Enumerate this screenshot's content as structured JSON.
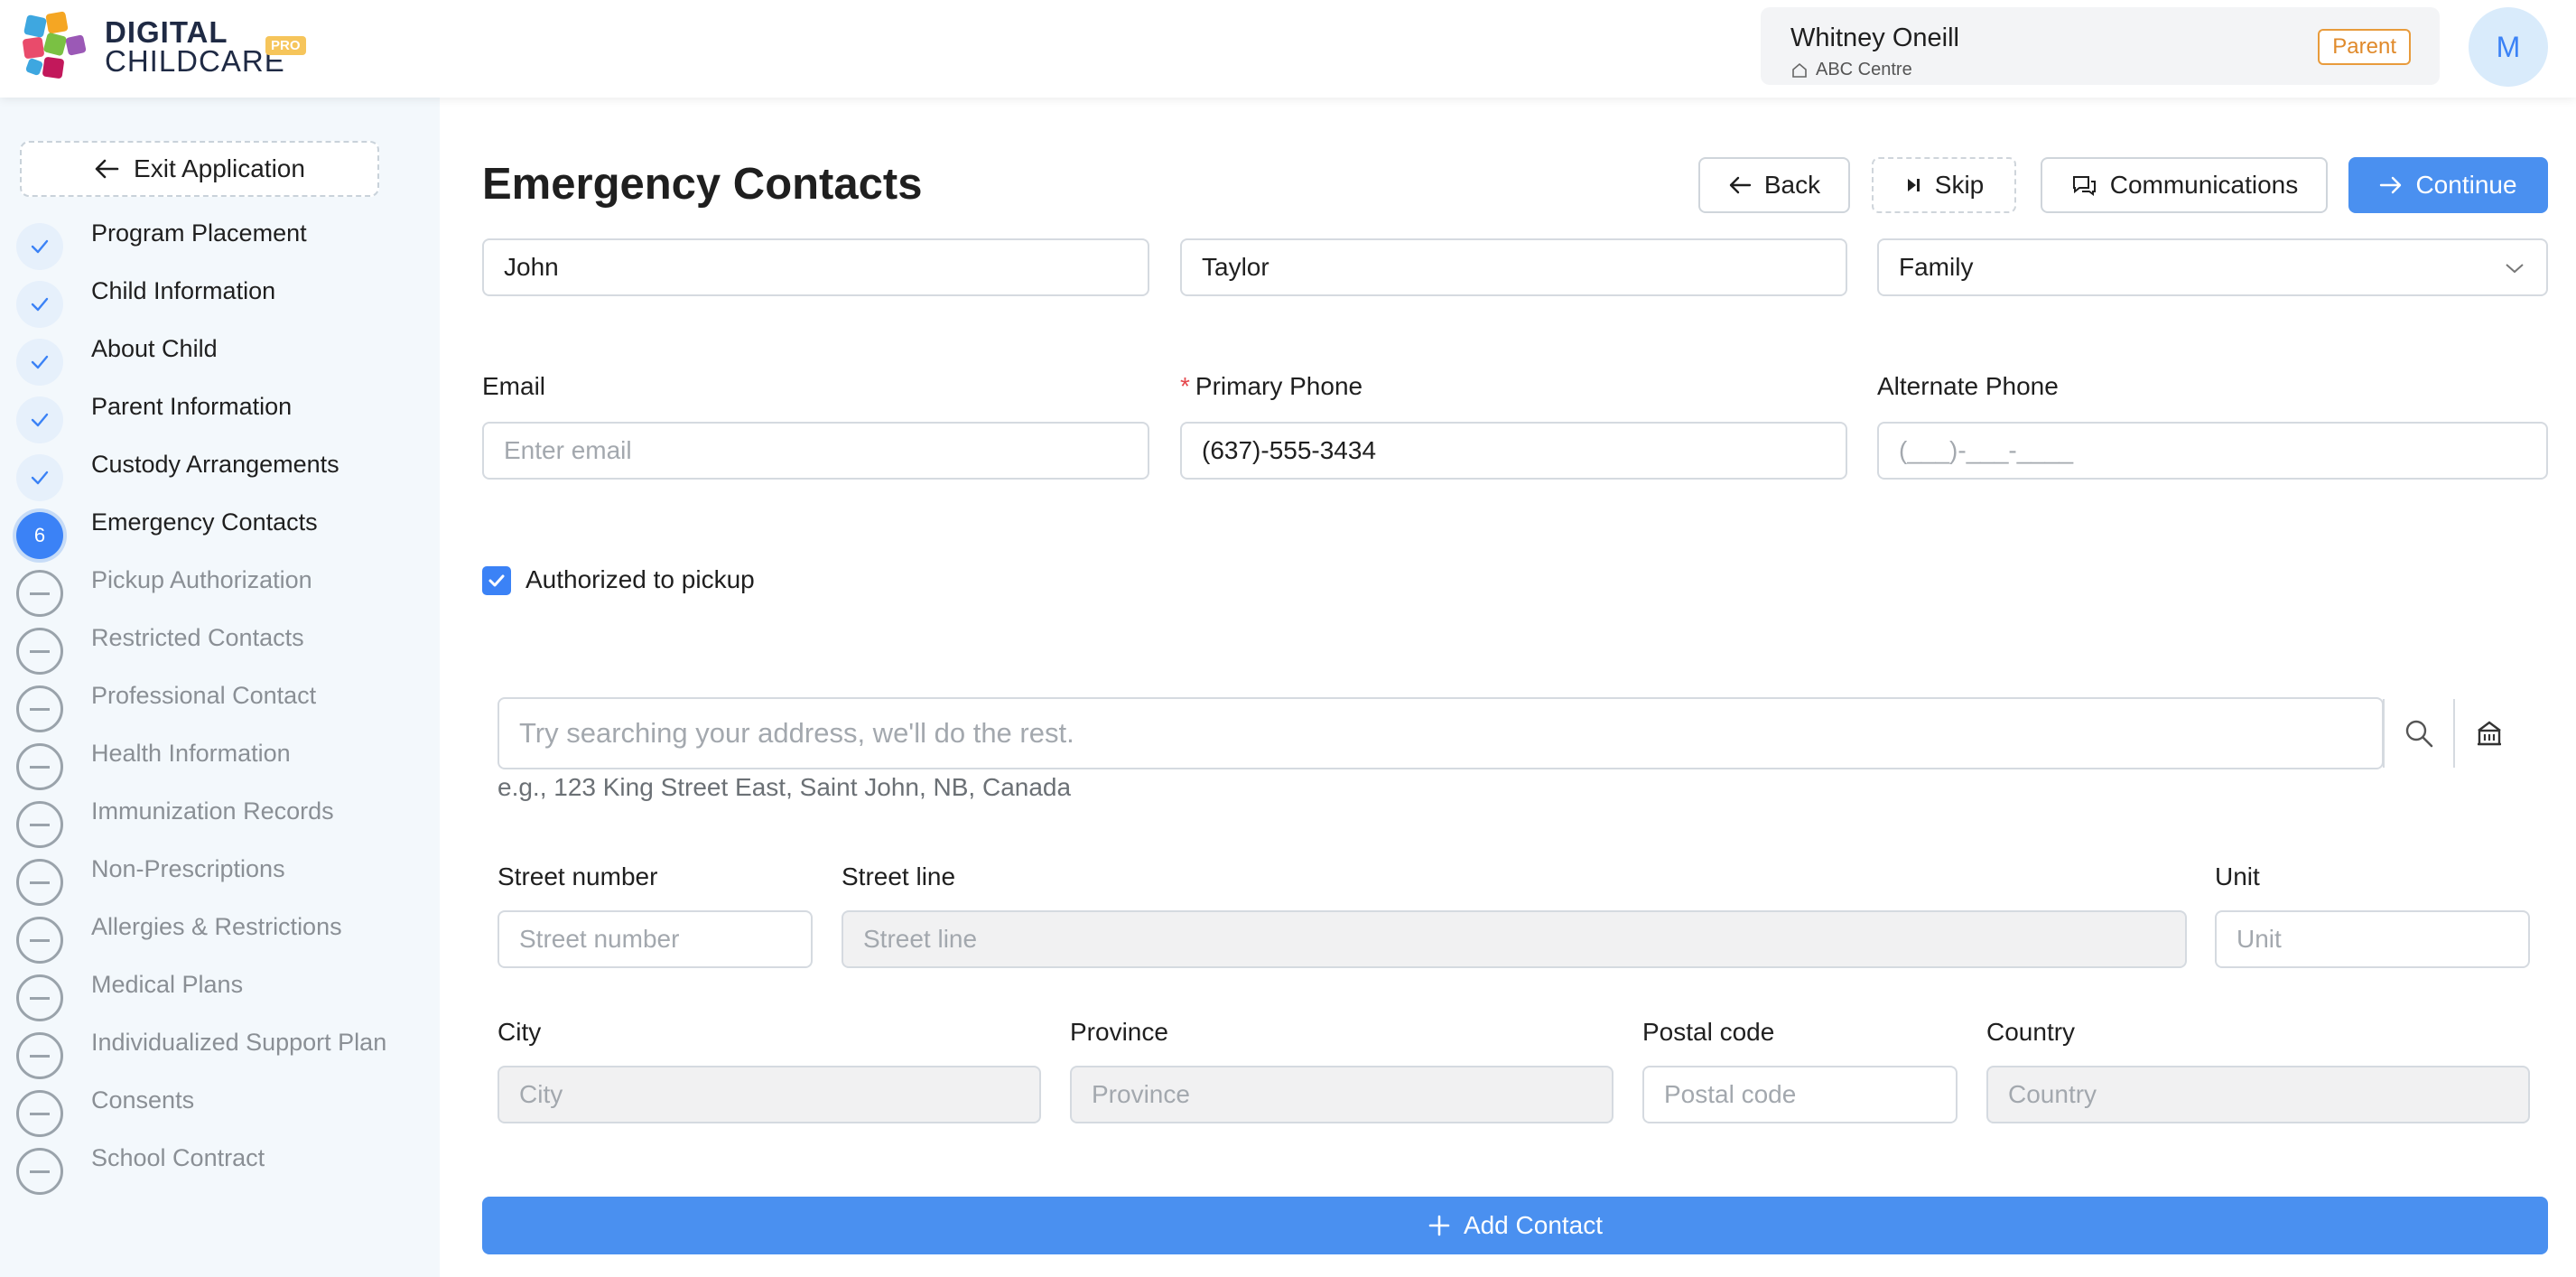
{
  "brand": {
    "line1": "DIGITAL",
    "line2": "CHILDCARE",
    "badge": "PRO"
  },
  "user": {
    "name": "Whitney Oneill",
    "centre": "ABC Centre",
    "role": "Parent",
    "avatar_initial": "M"
  },
  "sidebar": {
    "exit_label": "Exit Application",
    "steps": [
      {
        "label": "Program Placement",
        "status": "done"
      },
      {
        "label": "Child Information",
        "status": "done"
      },
      {
        "label": "About Child",
        "status": "done"
      },
      {
        "label": "Parent Information",
        "status": "done"
      },
      {
        "label": "Custody Arrangements",
        "status": "done"
      },
      {
        "label": "Emergency Contacts",
        "status": "current",
        "number": "6"
      },
      {
        "label": "Pickup Authorization",
        "status": "todo"
      },
      {
        "label": "Restricted Contacts",
        "status": "todo"
      },
      {
        "label": "Professional Contact",
        "status": "todo"
      },
      {
        "label": "Health Information",
        "status": "todo"
      },
      {
        "label": "Immunization Records",
        "status": "todo"
      },
      {
        "label": "Non-Prescriptions",
        "status": "todo"
      },
      {
        "label": "Allergies & Restrictions",
        "status": "todo"
      },
      {
        "label": "Medical Plans",
        "status": "todo"
      },
      {
        "label": "Individualized Support Plan",
        "status": "todo"
      },
      {
        "label": "Consents",
        "status": "todo"
      },
      {
        "label": "School Contract",
        "status": "todo"
      }
    ]
  },
  "page": {
    "title": "Emergency Contacts",
    "back_label": "Back",
    "skip_label": "Skip",
    "communications_label": "Communications",
    "continue_label": "Continue"
  },
  "contact": {
    "first_name": "John",
    "last_name": "Taylor",
    "relationship": "Family",
    "email_label": "Email",
    "email_placeholder": "Enter email",
    "primary_phone_label": "Primary Phone",
    "primary_phone_required": "*",
    "primary_phone": "(637)-555-3434",
    "alternate_phone_label": "Alternate Phone",
    "alternate_phone_placeholder": "(___)-___-____",
    "authorized_label": "Authorized to pickup",
    "authorized": true
  },
  "address": {
    "search_placeholder": "Try searching your address, we'll do the rest.",
    "hint": "e.g., 123 King Street East, Saint John, NB, Canada",
    "street_number_label": "Street number",
    "street_number_placeholder": "Street number",
    "street_line_label": "Street line",
    "street_line_placeholder": "Street line",
    "unit_label": "Unit",
    "unit_placeholder": "Unit",
    "city_label": "City",
    "city_placeholder": "City",
    "province_label": "Province",
    "province_placeholder": "Province",
    "postal_label": "Postal code",
    "postal_placeholder": "Postal code",
    "country_label": "Country",
    "country_placeholder": "Country"
  },
  "actions": {
    "add_contact_label": "Add Contact"
  },
  "colors": {
    "accent": "#4a90f0",
    "sidebar_bg": "#f3f8fc",
    "role_badge": "#e08a2b"
  }
}
